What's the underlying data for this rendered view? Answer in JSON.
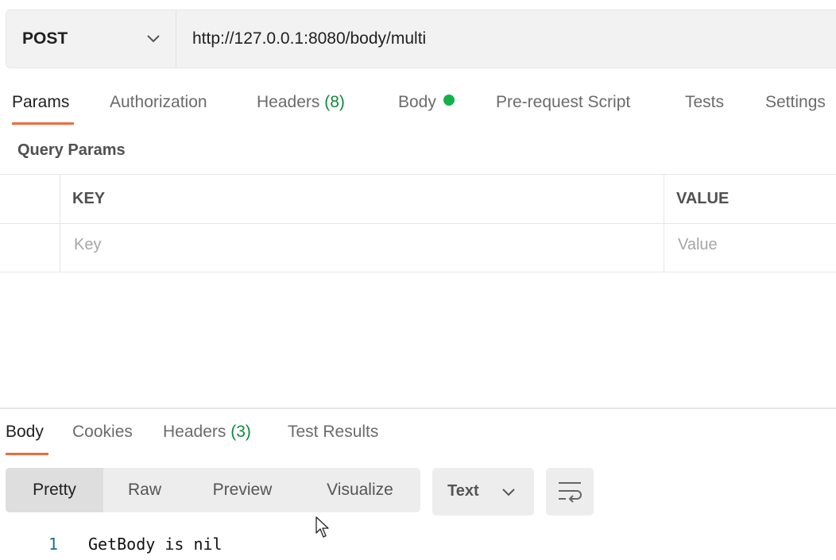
{
  "request": {
    "method": "POST",
    "url": "http://127.0.0.1:8080/body/multi"
  },
  "request_tabs": [
    {
      "label": "Params",
      "active": true
    },
    {
      "label": "Authorization"
    },
    {
      "label": "Headers",
      "count": "(8)"
    },
    {
      "label": "Body",
      "indicator": "green-dot"
    },
    {
      "label": "Pre-request Script"
    },
    {
      "label": "Tests"
    },
    {
      "label": "Settings"
    }
  ],
  "query_params": {
    "title": "Query Params",
    "columns": [
      "KEY",
      "VALUE"
    ],
    "placeholders": {
      "key": "Key",
      "value": "Value"
    }
  },
  "response_tabs": [
    {
      "label": "Body",
      "active": true
    },
    {
      "label": "Cookies"
    },
    {
      "label": "Headers",
      "count": "(3)"
    },
    {
      "label": "Test Results"
    }
  ],
  "format_buttons": [
    {
      "label": "Pretty",
      "active": true
    },
    {
      "label": "Raw"
    },
    {
      "label": "Preview"
    },
    {
      "label": "Visualize"
    }
  ],
  "language_select": {
    "value": "Text"
  },
  "response_body": {
    "lines": [
      {
        "number": "1",
        "text": "GetBody is nil"
      }
    ]
  },
  "colors": {
    "accent": "#f26b3a",
    "green": "#0fb34a"
  },
  "icons": [
    "chevron-down-icon",
    "wrap-lines-icon",
    "mouse-cursor-icon"
  ]
}
